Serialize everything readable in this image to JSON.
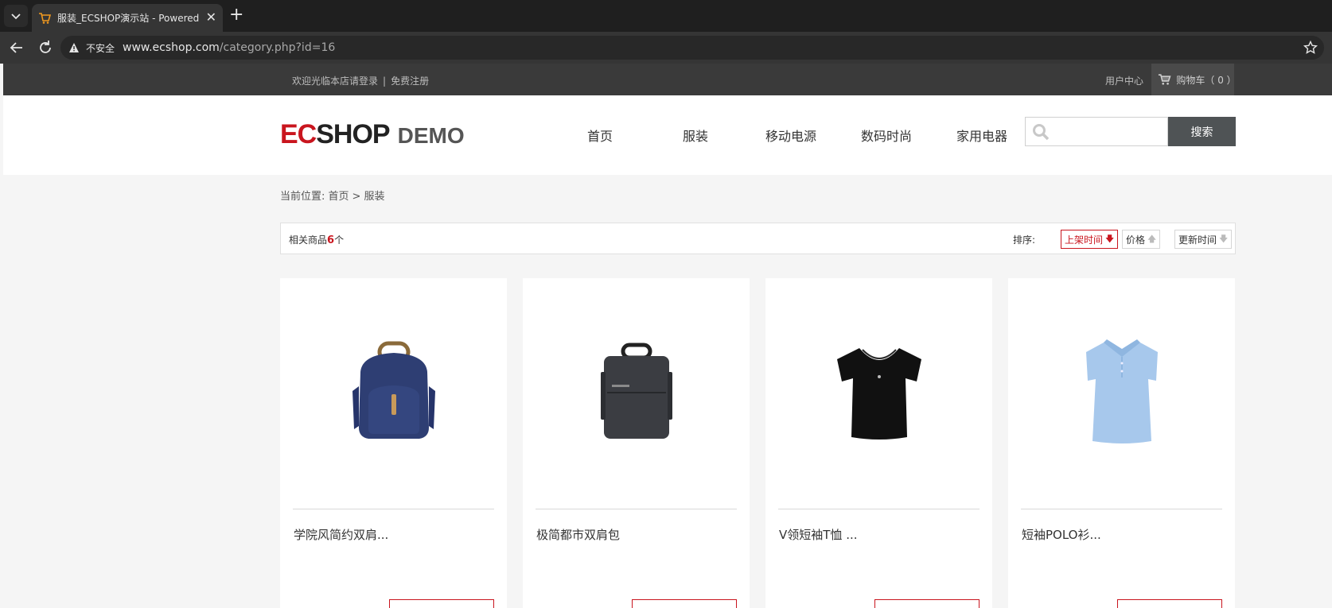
{
  "browser": {
    "tab_title": "服装_ECSHOP演示站 - Powered by ECShop",
    "insecure_label": "不安全",
    "url_host": "www.ecshop.com",
    "url_path": "/category.php?id=16"
  },
  "topbar": {
    "welcome": "欢迎光临本店请登录",
    "separator": "|",
    "register": "免费注册",
    "user_center": "用户中心",
    "cart_label": "购物车（ 0 ）"
  },
  "header": {
    "logo_ec": "EC",
    "logo_shop": "SHOP",
    "logo_demo": "DEMO",
    "nav": [
      "首页",
      "服装",
      "移动电源",
      "数码时尚",
      "家用电器"
    ],
    "search_placeholder": "",
    "search_button": "搜索"
  },
  "breadcrumb": {
    "prefix": "当前位置:",
    "home": "首页",
    "separator": ">",
    "current": "服装"
  },
  "filter": {
    "count_prefix": "相关商品",
    "count": "6",
    "count_suffix": "个",
    "sort_label": "排序:",
    "sort_options": [
      {
        "label": "上架时间",
        "arrow": "🡇",
        "active": true
      },
      {
        "label": "价格",
        "arrow": "🡅",
        "active": false
      },
      {
        "label": "更新时间",
        "arrow": "🡇",
        "active": false
      }
    ]
  },
  "products": [
    {
      "name": "学院风简约双肩...",
      "image": "backpack-navy-icon"
    },
    {
      "name": "极简都市双肩包",
      "image": "backpack-gray-icon"
    },
    {
      "name": "V领短袖T恤 ...",
      "image": "tshirt-black-icon"
    },
    {
      "name": "短袖POLO衫...",
      "image": "polo-blue-icon"
    }
  ],
  "colors": {
    "accent": "#c9151e",
    "topbar": "#3a3a3a",
    "search_button": "#4f5355"
  }
}
